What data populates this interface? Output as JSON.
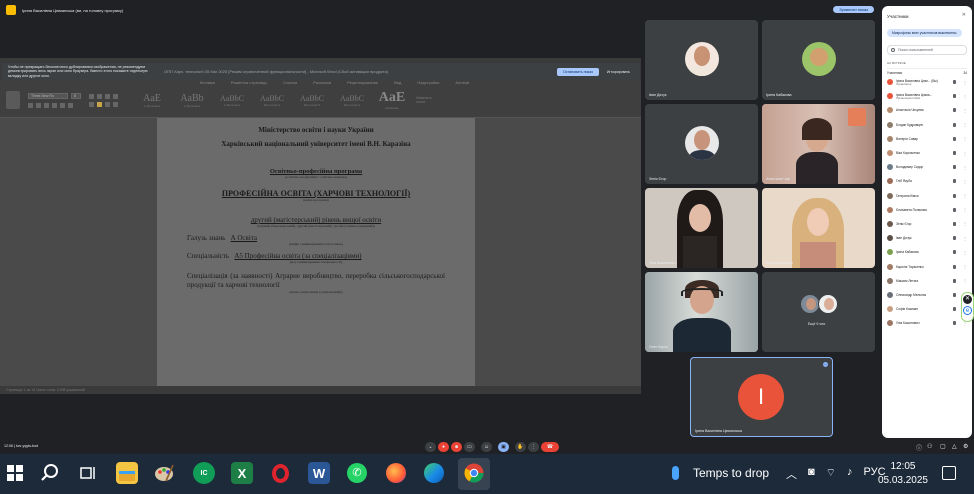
{
  "meet": {
    "top_bar": {
      "presenter_text": "Ірина Василівна Цюманська (ви, на головну програму)",
      "stop_present_label": "Зупинити показ"
    },
    "share_banner": {
      "text": "Чтобы не прекращать бесконечного дублирования изображения, не рекомендуем демонстрировать весь экран или окно браузера. Вместо этого покажите отдельную вкладку или другое окно.",
      "window_title": "ОПП Харч. технології 05 Mar 2025 [Режим ограниченной функциональности] - Microsoft Word (Сбой активации продукта)",
      "stop_btn": "Остановить показ",
      "ignore_btn": "Игнорировать"
    },
    "word": {
      "ribbon_tabs": [
        "Вставка",
        "Разметка страницы",
        "Ссылки",
        "Рассылки",
        "Рецензирование",
        "Вид",
        "Надстройки",
        "Acrobat"
      ],
      "font_name": "Times New Ro",
      "font_size": "8",
      "styles": [
        {
          "preview": "AaE",
          "name": "1 Заголовок"
        },
        {
          "preview": "AaBb",
          "name": "2 Заголовок"
        },
        {
          "preview": "AaBbC",
          "name": "3 Заголовок"
        },
        {
          "preview": "AaBbC",
          "name": "Заголовок 4"
        },
        {
          "preview": "AaBbC",
          "name": "Заголовок 5"
        },
        {
          "preview": "AaBbC",
          "name": "Заголовок 6"
        },
        {
          "preview": "AaE",
          "name": "Название"
        }
      ],
      "change_styles": "Изменить стили",
      "doc": {
        "l1": "Міністерство освіти і науки України",
        "l2": "Харківський національний університет імені В.Н. Каразіна",
        "l3": "Освітньо-професійна програма",
        "l3_sub": "(освітньо-професійна / освітньо-наукова)",
        "l4": "ПРОФЕСІЙНА ОСВІТА (ХАРЧОВІ ТЕХНОЛОГІЇ)",
        "l4_sub": "(назва програми)",
        "l5": "другий (магістерський) рівень вищої освіти",
        "l5_sub": "(перший (бакалаврський), другий (магістерський), третій (освітньо-науковий))",
        "field_label": "Галузь знань",
        "field_value": "А Освіта",
        "field_sub": "(шифр і найменування галузі знань)",
        "spec_label": "Спеціальність",
        "spec_value": "А5 Професійна освіта (за спеціалізаціями)",
        "spec_sub": "(код і найменування спеціальності)",
        "specialization": "Спеціалізація (за наявності) Аграрне виробництво, переробка сільськогосподарської продукції та харчові технології",
        "specialization_sub": "(назва спеціалізації (спеціалізацій))"
      },
      "status": "Страница: 1 из 19    Число слов: 3 838    украинский"
    },
    "tiles": [
      {
        "name": "Іван Дячук"
      },
      {
        "name": "Ірина Кабакова"
      },
      {
        "name": "Зенік Єгор"
      },
      {
        "name": "Анастасія Чир"
      },
      {
        "name": "Уліа Кошинович"
      },
      {
        "name": "Анна Кириченко"
      },
      {
        "name": "Олег Кирко"
      },
      {
        "name": "Ещё 9 чел."
      }
    ],
    "local": {
      "initial": "І",
      "name": "Ірина Василівна Цюманська"
    },
    "bottom": {
      "time": "12:06",
      "code": "kcv-yqyts-bod"
    }
  },
  "panel": {
    "title": "Участники",
    "mic_all": "Микрофоны всех участников выключены",
    "search_placeholder": "Поиск пользователей",
    "section_label": "НА ВСТРЕЧЕ",
    "section_head": "Участники",
    "section_count": "34",
    "participants": [
      {
        "name": "Ірина Василівна Цюм... (Вы)",
        "sub": "Организатор",
        "color": "#e8533a"
      },
      {
        "name": "Ірина Василівна Цюма...",
        "sub": "Презентация в Meet",
        "color": "#e8533a"
      },
      {
        "name": "Анастасія Чичуєва",
        "color": "#b58d6e"
      },
      {
        "name": "Богдан Кудрявцев",
        "color": "#8e7c6a"
      },
      {
        "name": "Валерія Савар",
        "color": "#a6846a"
      },
      {
        "name": "Віка Корсаченко",
        "color": "#c18e72"
      },
      {
        "name": "Володимир Сидор",
        "color": "#6c7b8a"
      },
      {
        "name": "Гліб Якуба",
        "color": "#9d6c58"
      },
      {
        "name": "Гатерина Кімса",
        "color": "#7f6a5c"
      },
      {
        "name": "Єлизавета Полякова",
        "color": "#b07a62"
      },
      {
        "name": "Зенік Єгор",
        "color": "#6b5a4d"
      },
      {
        "name": "Іван Дячук",
        "color": "#5e4f44"
      },
      {
        "name": "Ірина Кабакова",
        "color": "#7aa04f"
      },
      {
        "name": "Каролія Тарасенко",
        "color": "#a07c66"
      },
      {
        "name": "Максим Летяга",
        "color": "#8a7566"
      },
      {
        "name": "Олександр Мельник",
        "color": "#6a6f78"
      },
      {
        "name": "Софія Кошман",
        "color": "#c7a083"
      },
      {
        "name": "Уліа Кошинович",
        "color": "#9a7563"
      }
    ]
  },
  "taskbar": {
    "weather": "Temps to drop",
    "lang": "РУС",
    "time": "12:05",
    "date": "05.03.2025"
  },
  "colors": {
    "meet_bg": "#202124",
    "accent": "#8ab4f8",
    "end_call": "#ea4335",
    "local_avatar": "#e8533a"
  }
}
